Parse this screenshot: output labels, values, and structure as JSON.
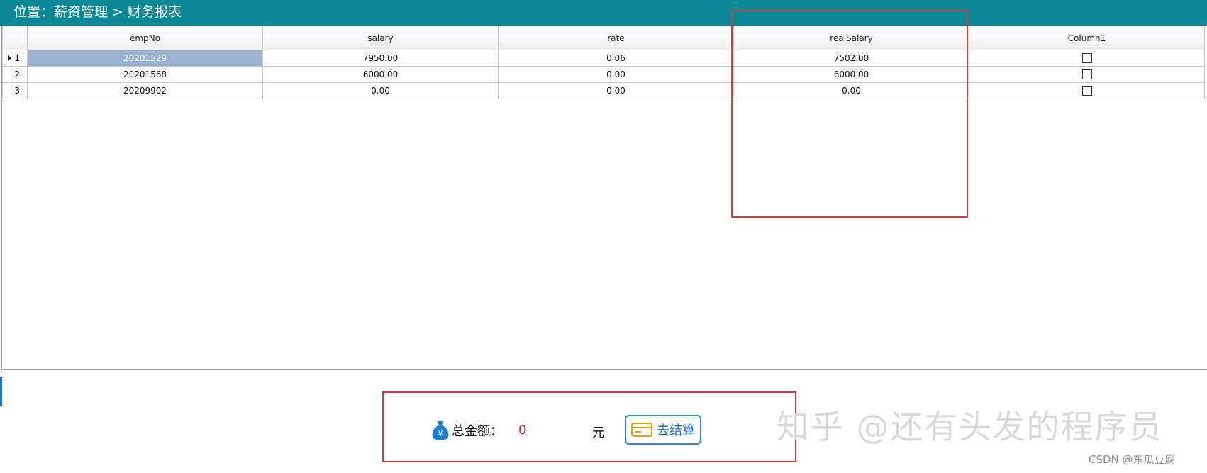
{
  "window": {
    "title": "位置：薪资管理 > 财务报表"
  },
  "grid": {
    "columns": [
      "empNo",
      "salary",
      "rate",
      "realSalary",
      "Column1"
    ],
    "rows": [
      {
        "index": "1",
        "empNo": "20201529",
        "salary": "7950.00",
        "rate": "0.06",
        "realSalary": "7502.00",
        "column1": false,
        "selected": true
      },
      {
        "index": "2",
        "empNo": "20201568",
        "salary": "6000.00",
        "rate": "0.00",
        "realSalary": "6000.00",
        "column1": false,
        "selected": false
      },
      {
        "index": "3",
        "empNo": "20209902",
        "salary": "0.00",
        "rate": "0.00",
        "realSalary": "0.00",
        "column1": false,
        "selected": false
      }
    ]
  },
  "footer": {
    "total_label": "总金额：",
    "total_value": "0",
    "currency": "元",
    "checkout_label": "去结算"
  },
  "watermark": {
    "text": "知乎 @还有头发的程序员",
    "csdn": "CSDN @东瓜豆腐"
  },
  "colors": {
    "titlebar": "#0a8896",
    "selected_row": "#9bb3d1",
    "highlight_box": "#d63a3a",
    "total_value": "#cc1f1f",
    "button_border": "#2a8ad2"
  }
}
